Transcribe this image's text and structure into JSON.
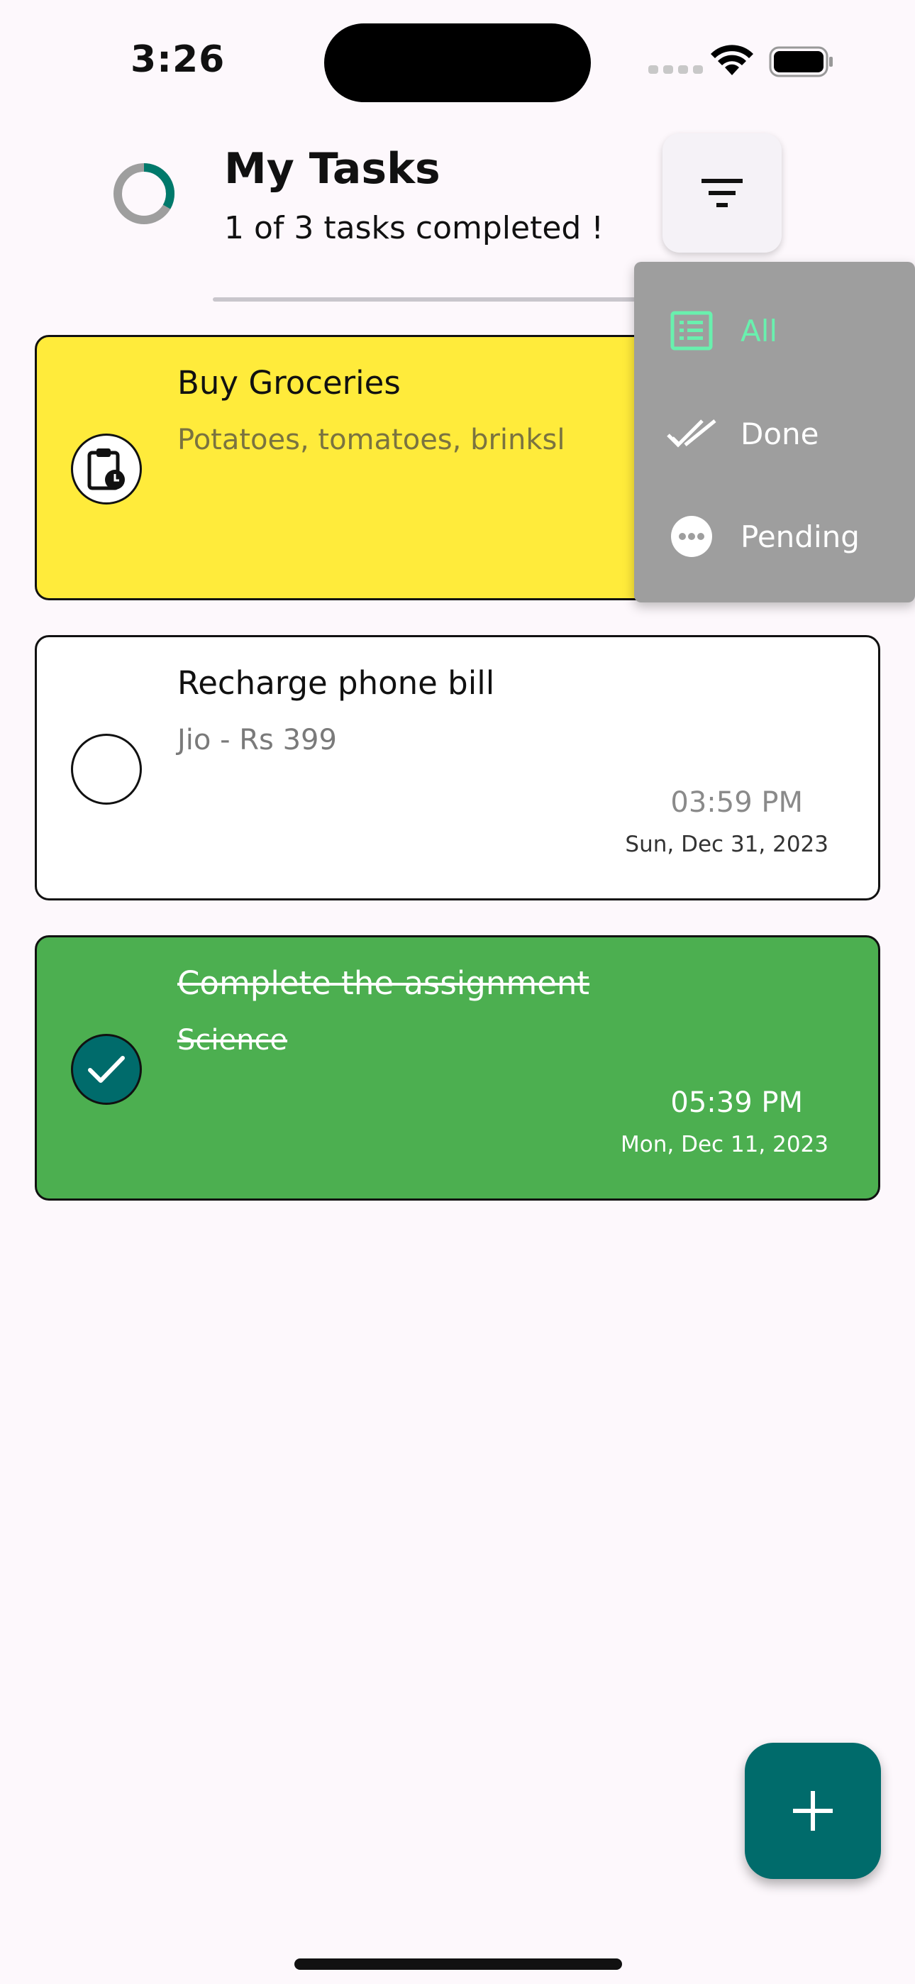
{
  "status_bar": {
    "time": "3:26"
  },
  "header": {
    "title": "My Tasks",
    "subtitle": "1 of 3 tasks completed !",
    "progress_fraction": 0.333
  },
  "tasks": [
    {
      "title": "Buy Groceries",
      "description": "Potatoes, tomatoes, brinksl",
      "time": "",
      "date": "",
      "status": "pending",
      "color": "#ffeb3b",
      "icon": "clipboard-clock-icon"
    },
    {
      "title": "Recharge phone bill",
      "description": "Jio - Rs 399",
      "time": "03:59 PM",
      "date": "Sun, Dec 31, 2023",
      "status": "pending",
      "color": "#ffffff",
      "icon": ""
    },
    {
      "title": "Complete the assignment",
      "description": "Science",
      "time": "05:39 PM",
      "date": "Mon, Dec 11, 2023",
      "status": "done",
      "color": "#4caf50",
      "icon": "check-icon"
    }
  ],
  "filter_menu": {
    "selected": "All",
    "items": [
      {
        "label": "All",
        "icon": "list-icon"
      },
      {
        "label": "Done",
        "icon": "double-check-icon"
      },
      {
        "label": "Pending",
        "icon": "more-horizontal-icon"
      }
    ]
  },
  "colors": {
    "accent": "#006b6b",
    "menu_active": "#69f0ae",
    "menu_background": "#9e9e9e"
  },
  "fab": {
    "icon": "plus-icon"
  }
}
